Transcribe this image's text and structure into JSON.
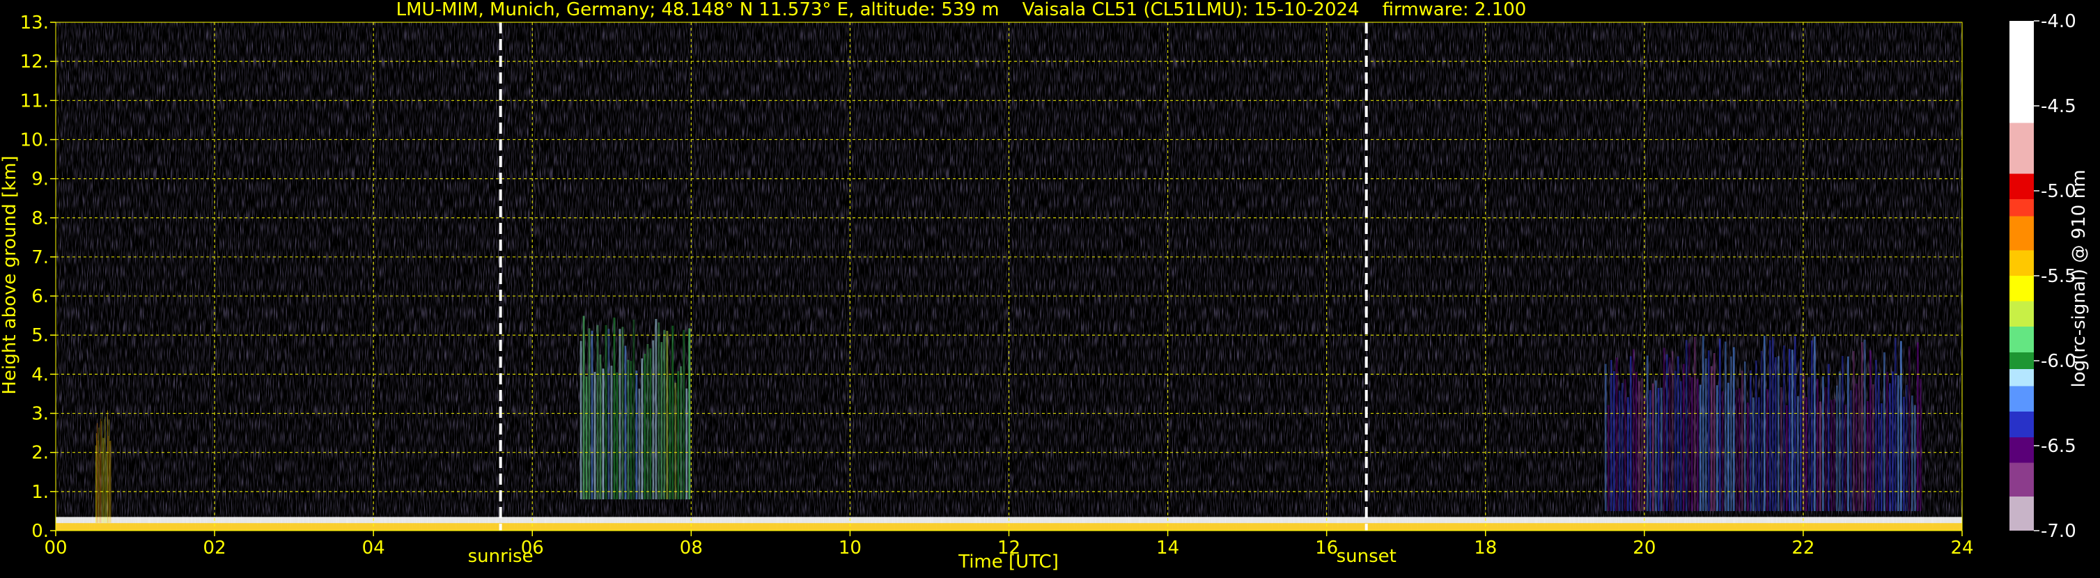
{
  "title": "LMU-MIM, Munich, Germany; 48.148° N 11.573° E, altitude: 539 m    Vaisala CL51 (CL51LMU): 15-10-2024    firmware: 2.100",
  "colors": {
    "text": "#ffff00",
    "grid": "#ffff00",
    "background": "#000000",
    "event_line": "#ffffff"
  },
  "chart_data": {
    "type": "heatmap",
    "xlabel": "Time [UTC]",
    "ylabel": "Height above ground [km]",
    "xlim": [
      0,
      24
    ],
    "ylim": [
      0,
      13
    ],
    "x_ticks": [
      "00",
      "02",
      "04",
      "06",
      "08",
      "10",
      "12",
      "14",
      "16",
      "18",
      "20",
      "22",
      "24"
    ],
    "x_tick_values": [
      0,
      2,
      4,
      6,
      8,
      10,
      12,
      14,
      16,
      18,
      20,
      22,
      24
    ],
    "y_ticks": [
      "0.",
      "1.",
      "2.",
      "3.",
      "4.",
      "5.",
      "6.",
      "7.",
      "8.",
      "9.",
      "10.",
      "11.",
      "12.",
      "13."
    ],
    "y_tick_values": [
      0,
      1,
      2,
      3,
      4,
      5,
      6,
      7,
      8,
      9,
      10,
      11,
      12,
      13
    ],
    "grid": true,
    "events": [
      {
        "label": "sunrise",
        "time": 5.6
      },
      {
        "label": "sunset",
        "time": 16.5
      }
    ],
    "colorbar": {
      "label": "log(rc-signal) @ 910 nm",
      "range": [
        -7.0,
        -4.0
      ],
      "ticks": [
        "-4.0",
        "-4.5",
        "-5.0",
        "-5.5",
        "-6.0",
        "-6.5",
        "-7.0"
      ],
      "tick_values": [
        -4.0,
        -4.5,
        -5.0,
        -5.5,
        -6.0,
        -6.5,
        -7.0
      ],
      "stops": [
        {
          "v": -7.0,
          "c": "#c8b4c8"
        },
        {
          "v": -6.8,
          "c": "#8c3c8c"
        },
        {
          "v": -6.6,
          "c": "#5a0078"
        },
        {
          "v": -6.45,
          "c": "#2832c8"
        },
        {
          "v": -6.3,
          "c": "#5a96ff"
        },
        {
          "v": -6.15,
          "c": "#b4e6ff"
        },
        {
          "v": -6.05,
          "c": "#1e9632"
        },
        {
          "v": -5.95,
          "c": "#64e682"
        },
        {
          "v": -5.8,
          "c": "#c8f046"
        },
        {
          "v": -5.65,
          "c": "#ffff00"
        },
        {
          "v": -5.5,
          "c": "#ffc800"
        },
        {
          "v": -5.35,
          "c": "#ff8c00"
        },
        {
          "v": -5.15,
          "c": "#ff3c1e"
        },
        {
          "v": -5.05,
          "c": "#e60000"
        },
        {
          "v": -4.9,
          "c": "#f0b4b4"
        },
        {
          "v": -4.6,
          "c": "#ffffff"
        },
        {
          "v": -4.0,
          "c": "#ffffff"
        }
      ]
    },
    "signal_features": [
      {
        "name": "surface boundary layer",
        "t_start": 0,
        "t_end": 24,
        "top_km": 0.35
      },
      {
        "name": "aerosol layer",
        "t_start": 6.6,
        "t_end": 8.0,
        "bottom_km": 0.8,
        "top_km": 5.5,
        "strength": -6.0
      },
      {
        "name": "diffuse aerosol",
        "t_start": 19.5,
        "t_end": 23.5,
        "bottom_km": 0.5,
        "top_km": 5.0,
        "strength": -6.4
      },
      {
        "name": "low cloud",
        "t_start": 0.5,
        "t_end": 0.7,
        "bottom_km": 0.2,
        "top_km": 3.1,
        "strength": -5.5
      }
    ]
  }
}
